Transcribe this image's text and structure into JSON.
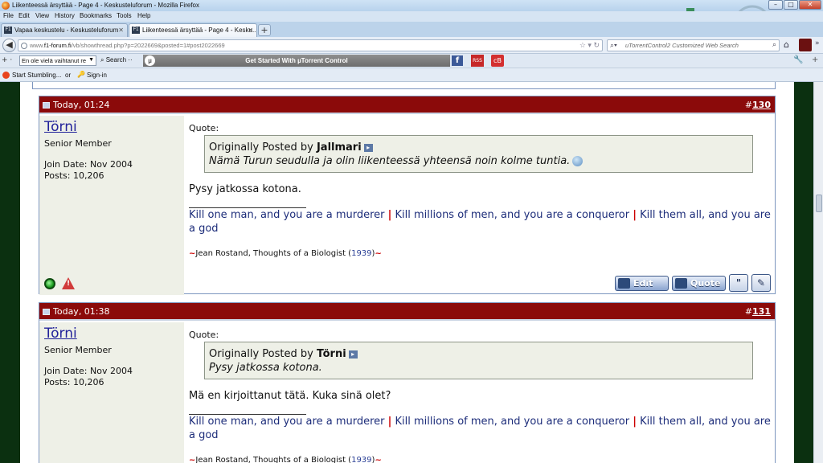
{
  "window": {
    "title": "Liikenteessä ärsyttää - Page 4 - Keskusteluforum - Mozilla Firefox"
  },
  "menu": [
    "File",
    "Edit",
    "View",
    "History",
    "Bookmarks",
    "Tools",
    "Help"
  ],
  "tabs": [
    {
      "label": "Vapaa keskustelu - Keskusteluforum",
      "active": false
    },
    {
      "label": "Liikenteessä ärsyttää - Page 4 - Kesku...",
      "active": true
    }
  ],
  "address": {
    "prefix": "www.",
    "domain": "f1-forum.fi",
    "path": "/vb/showthread.php?p=2022669&posted=1#post2022669"
  },
  "search": {
    "placeholder": "uTorrentControl2 Customized Web Search"
  },
  "toolbar": {
    "select_value": "En ole vielä vaihtanut re",
    "search_label": "Search",
    "banner": "Get Started With µTorrent Control",
    "facebook": "f",
    "rs": "RSS",
    "cb": "cB"
  },
  "stumble": {
    "start": "Start Stumbling...",
    "or": "or",
    "signin": "Sign-in"
  },
  "posts": [
    {
      "date": "Today, 01:24",
      "number_prefix": "#",
      "number": "130",
      "username": "Törni",
      "usertitle": "Senior Member",
      "join": "Join Date: Nov 2004",
      "posts": "Posts: 10,206",
      "quote_label": "Quote:",
      "quote_by_prefix": "Originally Posted by ",
      "quote_author": "Jallmari",
      "quote_text": "Nämä Turun seudulla ja olin liikenteessä yhteensä noin kolme tuntia.",
      "message": "Pysy jatkossa kotona."
    },
    {
      "date": "Today, 01:38",
      "number_prefix": "#",
      "number": "131",
      "username": "Törni",
      "usertitle": "Senior Member",
      "join": "Join Date: Nov 2004",
      "posts": "Posts: 10,206",
      "quote_label": "Quote:",
      "quote_by_prefix": "Originally Posted by ",
      "quote_author": "Törni",
      "quote_text": "Pysy jatkossa kotona.",
      "message": "Mä en kirjoittanut tätä. Kuka sinä olet?"
    }
  ],
  "signature": {
    "part1": "Kill one man, and you are a murderer",
    "sep": "|",
    "part2": "Kill millions of men, and you are a conqueror",
    "part3": "Kill them all, and you are a god",
    "credit_dash": "~",
    "credit": "Jean Rostand, Thoughts of a Biologist (",
    "credit_year": "1939",
    "credit_end": ")",
    "credit_dash_end": "~"
  },
  "buttons": {
    "edit": "Edit",
    "quote": "Quote"
  },
  "colors": {
    "post_header": "#8b0a0a",
    "user_panel": "#eef0e7",
    "link": "#22229a"
  }
}
